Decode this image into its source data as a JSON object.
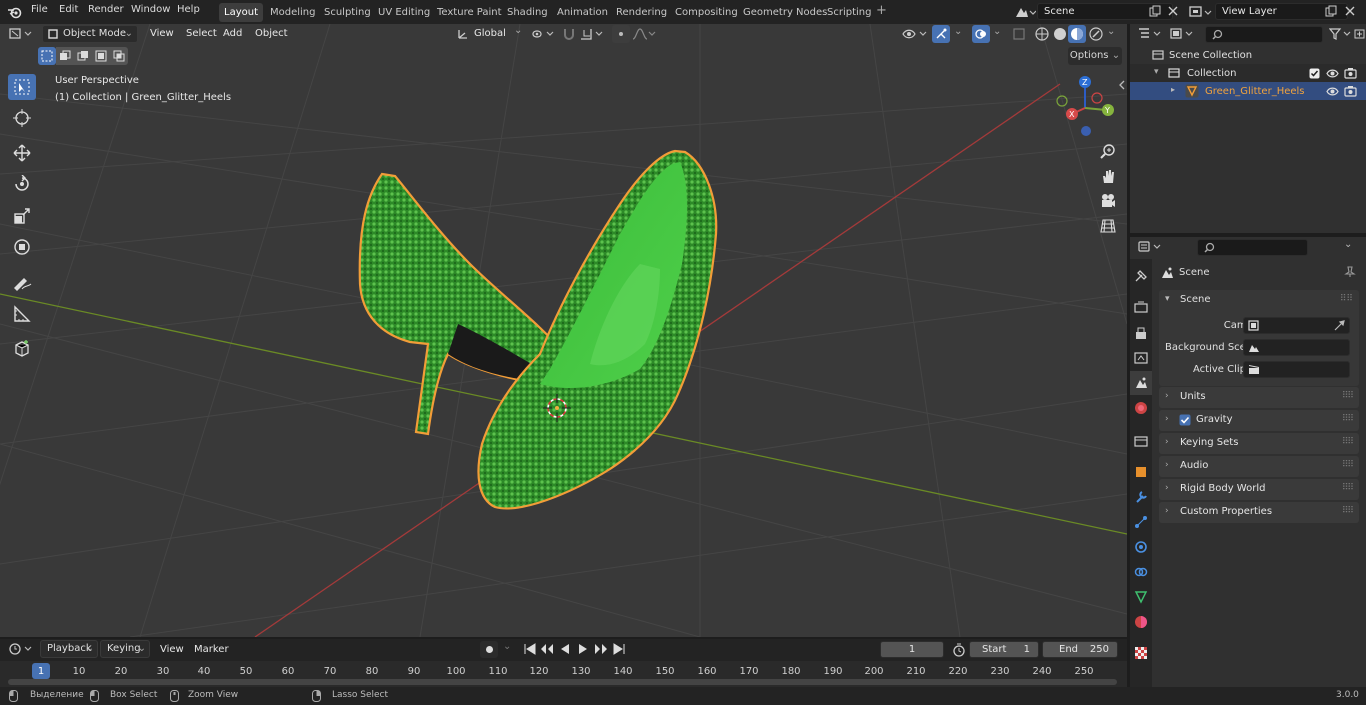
{
  "topbar": {
    "menus": [
      "File",
      "Edit",
      "Render",
      "Window",
      "Help"
    ],
    "workspaces": [
      "Layout",
      "Modeling",
      "Sculpting",
      "UV Editing",
      "Texture Paint",
      "Shading",
      "Animation",
      "Rendering",
      "Compositing",
      "Geometry Nodes",
      "Scripting"
    ],
    "active_workspace": "Layout",
    "add_workspace": "+",
    "scene_name": "Scene",
    "view_layer": "View Layer"
  },
  "viewport": {
    "mode": "Object Mode",
    "menus": [
      "View",
      "Select",
      "Add",
      "Object"
    ],
    "orientation": "Global",
    "options": "Options",
    "view_name": "User Perspective",
    "collection_info": "(1) Collection | Green_Glitter_Heels",
    "gizmo_axes": [
      "Z",
      "Y",
      "X"
    ]
  },
  "outliner": {
    "root": "Scene Collection",
    "collection": "Collection",
    "object": "Green_Glitter_Heels"
  },
  "properties": {
    "context": "Scene",
    "section": "Scene",
    "fields": [
      {
        "label": "Camera",
        "value": ""
      },
      {
        "label": "Background Sce...",
        "value": ""
      },
      {
        "label": "Active Clip",
        "value": ""
      }
    ],
    "panels": [
      "Units",
      "Gravity",
      "Keying Sets",
      "Audio",
      "Rigid Body World",
      "Custom Properties"
    ],
    "gravity_checked": true
  },
  "timeline": {
    "menus": [
      "Playback",
      "Keying",
      "View",
      "Marker"
    ],
    "current_frame": "1",
    "start_label": "Start",
    "start": "1",
    "end_label": "End",
    "end": "250",
    "ruler": [
      "1",
      "10",
      "20",
      "30",
      "40",
      "50",
      "60",
      "70",
      "80",
      "90",
      "100",
      "110",
      "120",
      "130",
      "140",
      "150",
      "160",
      "170",
      "180",
      "190",
      "200",
      "210",
      "220",
      "230",
      "240",
      "250"
    ]
  },
  "statusbar": {
    "items": [
      "Выделение",
      "Box Select",
      "Zoom View",
      "Lasso Select"
    ],
    "version": "3.0.0"
  },
  "colors": {
    "accent": "#4772b3",
    "selection_outline": "#f29d38",
    "shoe_green": "#2f8f2a",
    "x_axis": "#a33a3a",
    "y_axis": "#6a8a25"
  }
}
